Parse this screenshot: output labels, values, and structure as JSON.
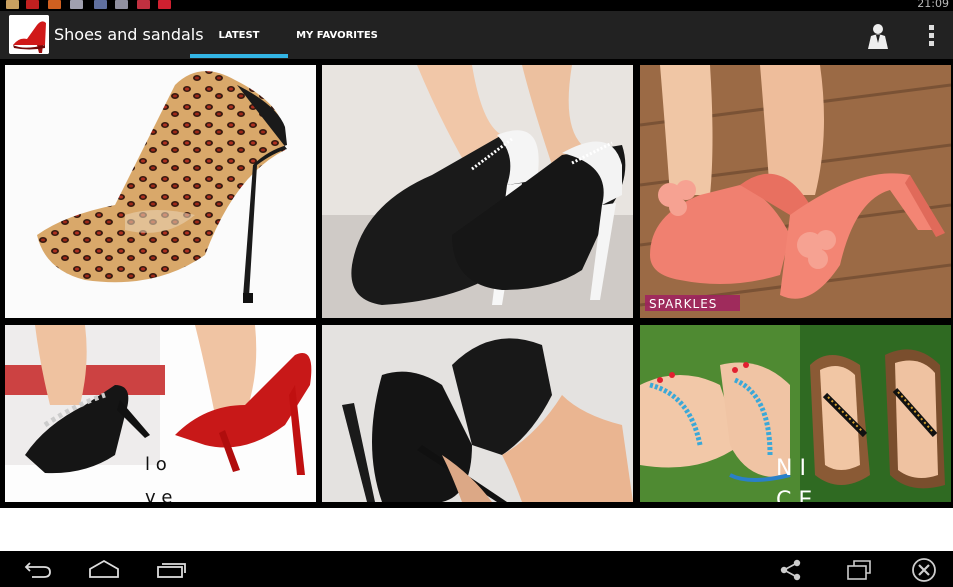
{
  "status_bar": {
    "time": "21:09",
    "notification_icons": [
      "shoe-notification-icon",
      "shoe-notification-icon",
      "shoe-notification-icon",
      "shoe-notification-icon",
      "shoe-notification-icon",
      "shoe-notification-icon",
      "shoe-notification-icon",
      "shoe-notification-icon"
    ]
  },
  "action_bar": {
    "app_title": "Shoes and sandals",
    "app_icon": "red-high-heel-icon",
    "tabs": [
      {
        "label": "LATEST",
        "selected": true
      },
      {
        "label": "MY FAVORITES",
        "selected": false
      }
    ],
    "accent_color": "#33b5e5",
    "user_icon": "user-icon",
    "overflow_icon": "overflow-menu-icon"
  },
  "grid": {
    "tiles": [
      {
        "subject": "leopard print stiletto pump"
      },
      {
        "subject": "black and white platform heels"
      },
      {
        "subject": "coral platform heels with flowers",
        "watermark": "SPARKLES"
      },
      {
        "subject": "black and red strappy heels",
        "overlay_text_1": "l o",
        "overlay_text_2": "v e"
      },
      {
        "subject": "black suede stilettos"
      },
      {
        "subject": "jeweled flat sandals",
        "overlay_text_1": "N I",
        "overlay_text_2": "C E"
      }
    ]
  },
  "nav_bar": {
    "icons": [
      "back-icon",
      "home-icon",
      "recent-apps-icon",
      "share-icon",
      "window-icon",
      "close-icon"
    ]
  }
}
